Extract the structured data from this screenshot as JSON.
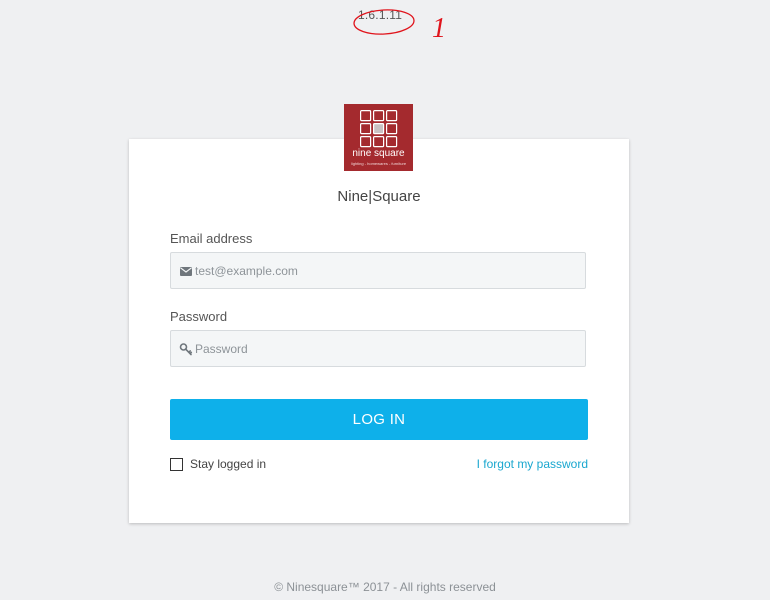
{
  "version": "1.6.1.11",
  "annotation": {
    "mark": "1",
    "color": "#e0141c"
  },
  "logo": {
    "text": "nine square",
    "tagline": "lighting - homewares - furniture",
    "bg_color": "#a42a2e"
  },
  "brand": {
    "left": "Nine",
    "separator": "|",
    "right": "Square"
  },
  "form": {
    "email_label": "Email address",
    "email_placeholder": "test@example.com",
    "email_icon": "envelope-icon",
    "password_label": "Password",
    "password_placeholder": "Password",
    "password_icon": "key-icon",
    "login_label": "LOG IN",
    "remember_label": "Stay logged in",
    "remember_checked": false,
    "forgot_label": "I forgot my password"
  },
  "colors": {
    "accent": "#0eb0ea",
    "link": "#1aa7cf",
    "background": "#eff0f2"
  },
  "footer": {
    "text": "© Ninesquare™ 2017 - All rights reserved"
  }
}
